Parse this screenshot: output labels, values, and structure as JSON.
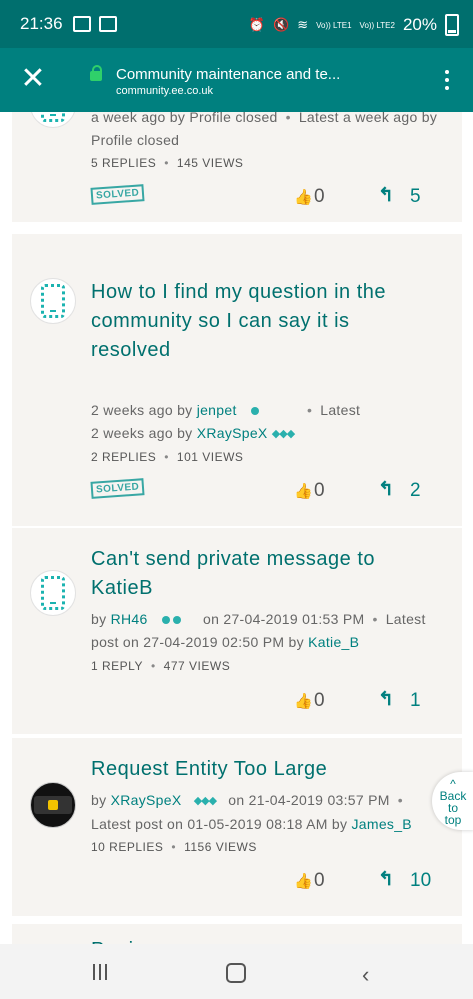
{
  "status": {
    "time": "21:36",
    "battery": "20%",
    "signal1": "Vo)) LTE1",
    "signal2": "Vo)) LTE2"
  },
  "appbar": {
    "title": "Community maintenance and te...",
    "url": "community.ee.co.uk"
  },
  "posts": [
    {
      "meta_line1": "a week ago by Profile closed",
      "latest_label": "Latest a week ago by",
      "meta_line2": "Profile closed",
      "replies": "5 REPLIES",
      "views": "145 VIEWS",
      "badge": "SOLVED",
      "likes": "0",
      "reply_count": "5"
    },
    {
      "title_lines": [
        "How to I find my question in the",
        "community so I can say it is",
        "resolved"
      ],
      "age": "2 weeks ago by",
      "author": "jenpet",
      "latest_label": "Latest",
      "latest_age": "2 weeks ago by",
      "latest_author": "XRaySpeX",
      "replies": "2 REPLIES",
      "views": "101 VIEWS",
      "badge": "SOLVED",
      "likes": "0",
      "reply_count": "2"
    },
    {
      "title_lines": [
        "Can't send private message to",
        "KatieB"
      ],
      "by": "by",
      "author": "RH46",
      "posted": "on 27-04-2019 01:53 PM",
      "latest_label": "Latest",
      "latest_prefix": "post on 27-04-2019 02:50 PM by",
      "latest_author": "Katie_B",
      "replies": "1 REPLY",
      "views": "477 VIEWS",
      "likes": "0",
      "reply_count": "1"
    },
    {
      "title_lines": [
        "Request Entity Too Large"
      ],
      "by": "by",
      "author": "XRaySpeX",
      "posted": "on 21-04-2019 03:57 PM",
      "latest_prefix": "Latest post on 01-05-2019 08:18 AM by",
      "latest_author": "James_B",
      "replies": "10 REPLIES",
      "views": "1156 VIEWS",
      "likes": "0",
      "reply_count": "10"
    }
  ],
  "back_to_top": [
    "Back",
    "to",
    "top"
  ],
  "partial_next_title": "Pa..i.."
}
